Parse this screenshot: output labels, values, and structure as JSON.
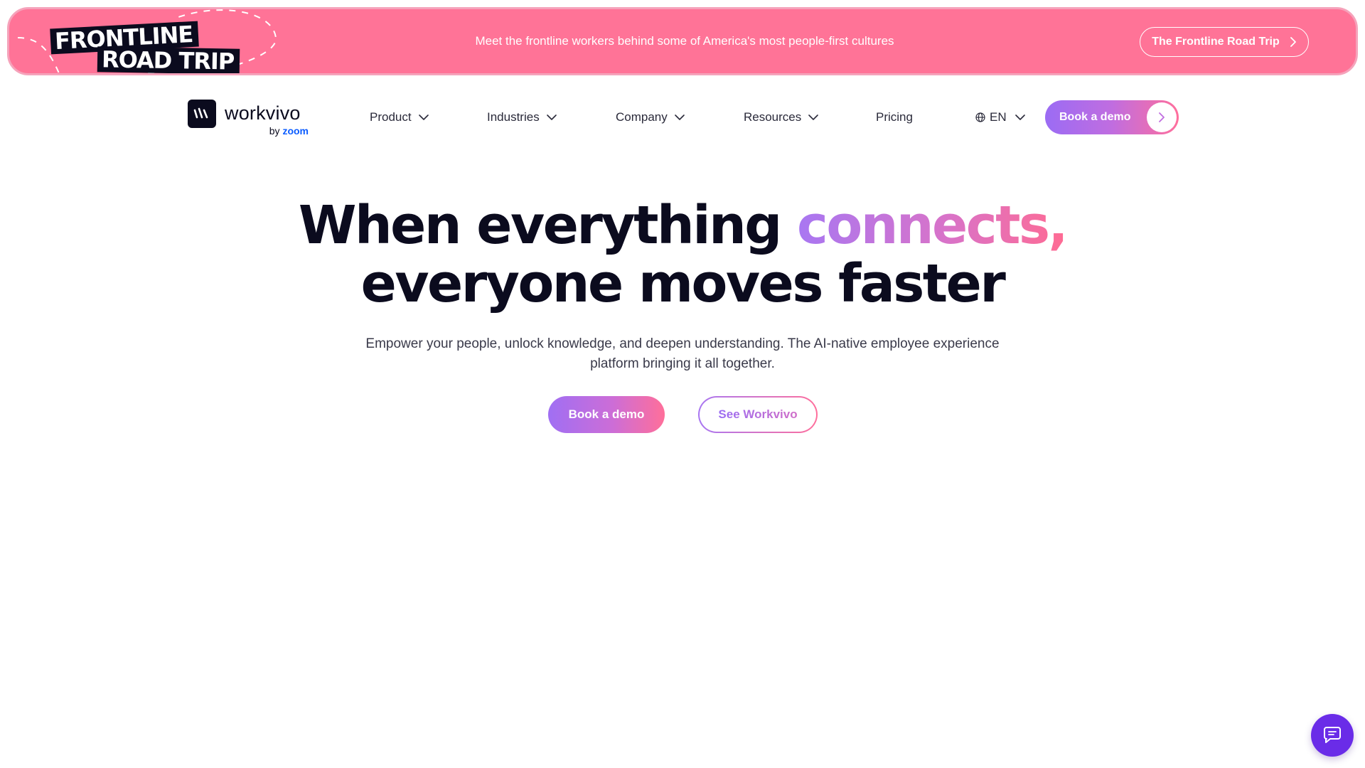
{
  "promo": {
    "logo_line1": "FRONTLINE",
    "logo_line2": "ROAD TRIP",
    "message": "Meet the frontline workers behind some of America's most people-first cultures",
    "cta_label": "The Frontline Road Trip",
    "background_color": "#ff7397"
  },
  "brand": {
    "name": "workvivo",
    "by": "by",
    "by_brand": "zoom",
    "logo_icon": "workvivo-mark-icon"
  },
  "nav": {
    "items": [
      {
        "label": "Product",
        "has_dropdown": true
      },
      {
        "label": "Industries",
        "has_dropdown": true
      },
      {
        "label": "Company",
        "has_dropdown": true
      },
      {
        "label": "Resources",
        "has_dropdown": true
      },
      {
        "label": "Pricing",
        "has_dropdown": false
      }
    ],
    "language": "EN",
    "cta_label": "Book a demo"
  },
  "hero": {
    "title_part1": "When everything ",
    "title_highlight": "connects,",
    "title_line2": "everyone moves faster",
    "subtitle": "Empower your people, unlock knowledge, and deepen understanding. The AI-native employee experience platform bringing it all together.",
    "primary_button": "Book a demo",
    "secondary_button": "See Workvivo"
  },
  "colors": {
    "accent_purple": "#9b6cf4",
    "accent_pink": "#ff6f9c",
    "text_dark": "#0b0b1e",
    "chat_button": "#6a2ce8",
    "zoom_blue": "#0b5cff"
  },
  "chat": {
    "icon": "chat-bubble-icon"
  }
}
